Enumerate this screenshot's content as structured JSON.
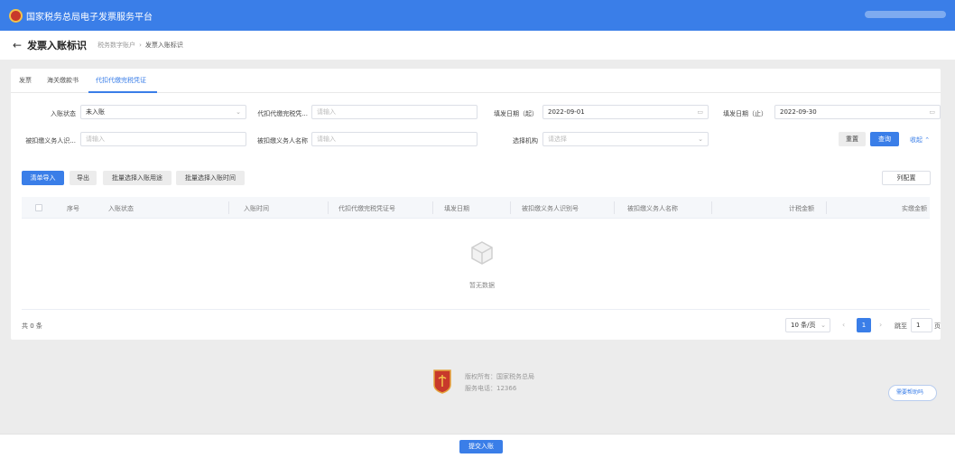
{
  "header": {
    "site_title": "国家税务总局电子发票服务平台"
  },
  "subheader": {
    "back_icon": "arrow-left-icon",
    "title": "发票入账标识",
    "breadcrumb_parent": "税务数字账户",
    "breadcrumb_sep": "›",
    "breadcrumb_current": "发票入账标识"
  },
  "tabs": [
    {
      "label": "发票"
    },
    {
      "label": "海关缴款书"
    },
    {
      "label": "代扣代缴完税凭证"
    }
  ],
  "filters": {
    "status_label": "入账状态",
    "status_value": "未入账",
    "voucher_label": "代扣代缴完税凭...",
    "voucher_placeholder": "请输入",
    "date_start_label": "填发日期（起）",
    "date_start_value": "2022-09-01",
    "date_end_label": "填发日期（止）",
    "date_end_value": "2022-09-30",
    "taxpayer_id_label": "被扣缴义务人识...",
    "taxpayer_id_placeholder": "请输入",
    "taxpayer_name_label": "被扣缴义务人名称",
    "taxpayer_name_placeholder": "请输入",
    "org_label": "选择机构",
    "org_placeholder": "请选择",
    "select_arrow": "⌄",
    "calendar_icon": "▭",
    "reset_label": "重置",
    "query_label": "查询",
    "collapse_label": "收起 ⌃"
  },
  "toolbar": {
    "import_label": "清单导入",
    "export_label": "导出",
    "batch_purpose_label": "批量选择入账用途",
    "batch_time_label": "批量选择入账时间",
    "column_config_label": "列配置"
  },
  "table": {
    "columns": [
      "序号",
      "入账状态",
      "入账时间",
      "代扣代缴完税凭证号",
      "填发日期",
      "被扣缴义务人识别号",
      "被扣缴义务人名称",
      "计税金额",
      "实缴金额"
    ],
    "empty_text": "暂无数据"
  },
  "pagination": {
    "total": "共 0 条",
    "page_size": "10 条/页",
    "prev": "‹",
    "next": "›",
    "current_page": "1",
    "goto_label": "跳至",
    "goto_value": "1",
    "page_suffix": "页"
  },
  "footer": {
    "copyright": "版权所有：国家税务总局",
    "hotline": "服务电话：12366",
    "help_label": "需要帮助吗"
  },
  "actions": {
    "submit_label": "提交入账"
  },
  "colors": {
    "primary": "#3a7ee8",
    "logo_red": "#c8392b"
  }
}
